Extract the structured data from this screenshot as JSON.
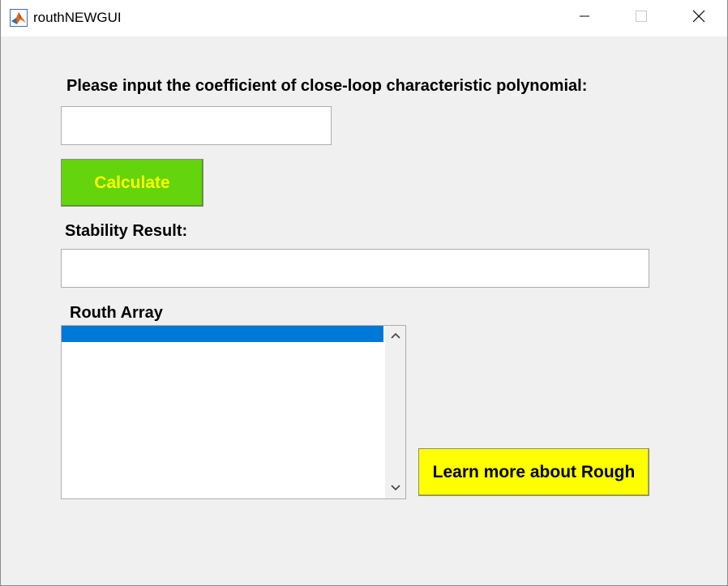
{
  "window": {
    "title": "routhNEWGUI",
    "app_icon": "matlab-icon",
    "controls": {
      "minimize_icon": "minimize-icon",
      "maximize_icon": "maximize-icon",
      "close_icon": "close-icon"
    }
  },
  "form": {
    "coefficient_label": "Please input the coefficient of close-loop characteristic polynomial:",
    "coefficient_value": "",
    "calculate_label": "Calculate",
    "stability_label": "Stability Result:",
    "stability_value": "",
    "routh_label": "Routh Array",
    "routh_items": [],
    "learn_more_label": "Learn more about Rough"
  },
  "colors": {
    "calculate_bg": "#64d40c",
    "calculate_text": "#ffff00",
    "learn_more_bg": "#ffff00",
    "selection": "#0078d7",
    "window_bg": "#f0f0f0"
  }
}
